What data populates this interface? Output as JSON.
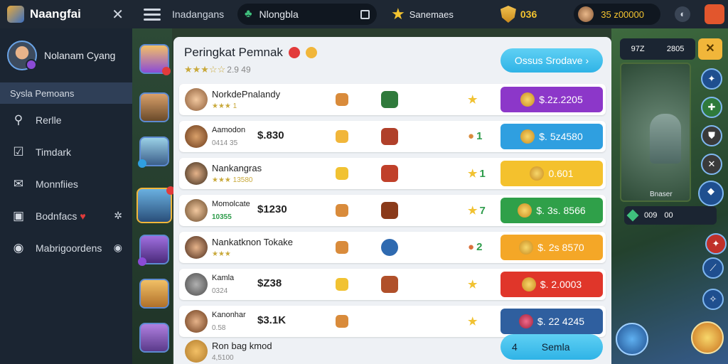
{
  "topbar": {
    "app_name": "Naangfai",
    "close_glyph": "✕",
    "crumb": "Inadangans",
    "search_value": "Nlongbla",
    "stars_label": "Sanemaes",
    "shield_count": "036",
    "coins": "35 z00000"
  },
  "sidebar": {
    "profile_name": "Nolanam Cyang",
    "items": [
      {
        "label": "Sysla Pemoans",
        "icon": ""
      },
      {
        "label": "Rerlle",
        "icon": "search-icon"
      },
      {
        "label": "Timdark",
        "icon": "check-box-icon"
      },
      {
        "label": "Monnfiies",
        "icon": "mail-icon"
      },
      {
        "label": "Bodnfacs",
        "icon": "chat-icon",
        "trail": "settings-icon"
      },
      {
        "label": "Mabrigoordens",
        "icon": "info-icon",
        "trail": "eye-icon"
      }
    ]
  },
  "panel": {
    "title": "Peringkat Pemnak",
    "rating_text": "2.9 49",
    "cta_label": "Ossus  Srodave  ›",
    "more_count": "4",
    "more_label": "Semla"
  },
  "rows": [
    {
      "name": "NorkdePnalandy",
      "sub": "",
      "score": "",
      "rank": "",
      "tag": "$.2z.2205",
      "tag_color": "#8c37c9",
      "sub_stars": "★★★ 1"
    },
    {
      "name": "Aamodon",
      "sub": "0414 35",
      "score": "$.830",
      "rank": "1",
      "tag": "$. 5z4580",
      "tag_color": "#2f9fe0"
    },
    {
      "name": "Nankangras",
      "sub": "",
      "score": "",
      "rank": "1",
      "tag": "0.601",
      "tag_color": "#f4c12d",
      "sub_stars": "★★★ 13580"
    },
    {
      "name": "Momolcate",
      "sub": "10355",
      "score": "$1230",
      "rank": "7",
      "tag": "$. 3s. 8566",
      "tag_color": "#2fa049"
    },
    {
      "name": "Nankatknon Tokake",
      "sub": "",
      "score": "",
      "rank": "2",
      "tag": "$. 2s 8570",
      "tag_color": "#f4a727",
      "sub_stars": "★★★"
    },
    {
      "name": "Kamla",
      "sub": "0324",
      "score": "$Z38",
      "rank": "",
      "tag": "$. 2.0003",
      "tag_color": "#e0362a"
    },
    {
      "name": "Kanonhar",
      "sub": "0.58",
      "score": "$3.1K",
      "rank": "",
      "tag": "$. 22 4245",
      "tag_color": "#2f5f9f"
    },
    {
      "name": "Ron bag kmod",
      "sub": "4,5100",
      "score": "",
      "rank": "",
      "tag": "",
      "tag_color": ""
    }
  ],
  "game": {
    "hud_left": "97Z",
    "hud_right": "2805",
    "hero_label": "Bnaser",
    "res_a": "009",
    "res_b": "00"
  }
}
